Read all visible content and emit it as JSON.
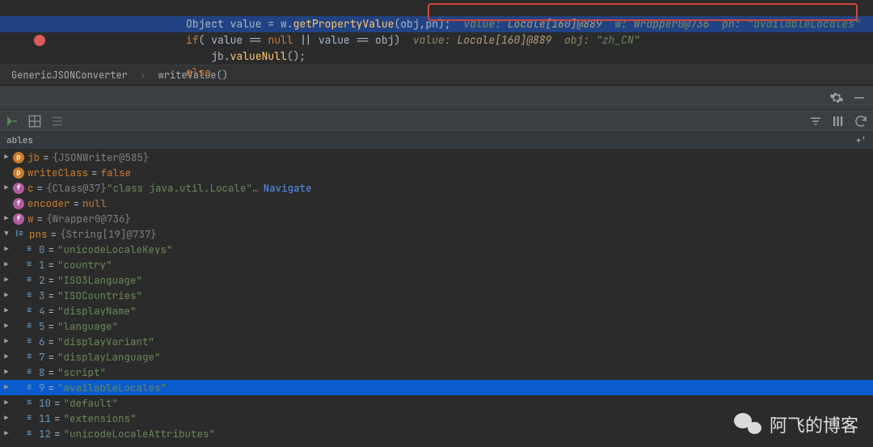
{
  "editor": {
    "lines": {
      "l1_pre": "                     ",
      "l1_tok1": "Object",
      "l1_tok2": " value = w.",
      "l1_tok3": "getPropertyValue",
      "l1_tok4": "(obj,pn);  ",
      "l1_inlay": "value: ",
      "l1_inlay_type": "Locale[160]@889",
      "l1_inlay2": "  w: Wrapper0@736  pn: ",
      "l1_inlay_str": "\"availableLocales\"",
      "l2_pre": "                     ",
      "l2_tok1": "if",
      "l2_tok2": "( value == ",
      "l2_tok3": "null",
      "l2_tok4": " || value == obj)  ",
      "l2_inlay": "value: ",
      "l2_inlay_type": "Locale[160]@889",
      "l2_inlay2": "  obj: ",
      "l2_inlay_str": "\"zh_CN\"",
      "l3_pre": "                         ",
      "l3_tok1": "jb.",
      "l3_tok2": "valueNull",
      "l3_tok3": "();",
      "l4_pre": "                     ",
      "l4_tok1": "else"
    }
  },
  "breadcrumb": {
    "item1": "GenericJSONConverter",
    "item2": "writeValue()"
  },
  "tabs": {
    "vars_label": "ables",
    "plus": "+'"
  },
  "vars": [
    {
      "arrow": "▶",
      "icon": "p",
      "name": "jb",
      "obj": "{JSONWriter@585}"
    },
    {
      "arrow": "",
      "icon": "p",
      "name": "writeClass",
      "kw": "false"
    },
    {
      "arrow": "▶",
      "icon": "f",
      "name": "c",
      "obj": "{Class@37}",
      "str": " \"class java.util.Locale\"",
      "extra": " …",
      "link": "Navigate"
    },
    {
      "arrow": "",
      "icon": "f",
      "name": "encoder",
      "kw": "null"
    },
    {
      "arrow": "▶",
      "icon": "f",
      "name": "w",
      "obj": "{Wrapper0@736}"
    },
    {
      "arrow": "▼",
      "icon": "arr",
      "name": "pns",
      "obj": "{String[19]@737}"
    }
  ],
  "array_items": [
    {
      "idx": "0",
      "val": "\"unicodeLocaleKeys\""
    },
    {
      "idx": "1",
      "val": "\"country\""
    },
    {
      "idx": "2",
      "val": "\"ISO3Language\""
    },
    {
      "idx": "3",
      "val": "\"ISOCountries\""
    },
    {
      "idx": "4",
      "val": "\"displayName\""
    },
    {
      "idx": "5",
      "val": "\"language\""
    },
    {
      "idx": "6",
      "val": "\"displayVariant\""
    },
    {
      "idx": "7",
      "val": "\"displayLanguage\""
    },
    {
      "idx": "8",
      "val": "\"script\""
    },
    {
      "idx": "9",
      "val": "\"availableLocales\"",
      "highlight": true
    },
    {
      "idx": "10",
      "val": "\"default\""
    },
    {
      "idx": "11",
      "val": "\"extensions\""
    },
    {
      "idx": "12",
      "val": "\"unicodeLocaleAttributes\""
    }
  ],
  "watermark": {
    "text": "阿飞的博客"
  }
}
